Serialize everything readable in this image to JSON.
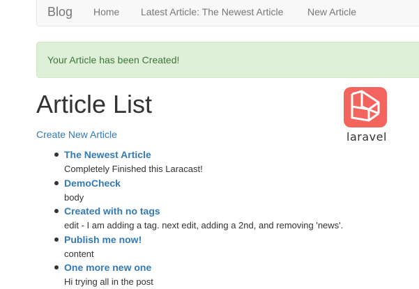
{
  "navbar": {
    "brand": "Blog",
    "links": [
      "Home",
      "Latest Article: The Newest Article",
      "New Article"
    ]
  },
  "alert": {
    "message": "Your Article has been Created!"
  },
  "main": {
    "title": "Article List",
    "create_link": "Create New Article"
  },
  "logo": {
    "text": "laravel",
    "color": "#f4645f"
  },
  "articles": [
    {
      "title": "The Newest Article",
      "body": "Completely Finished this Laracast!"
    },
    {
      "title": "DemoCheck",
      "body": "body"
    },
    {
      "title": "Created with no tags",
      "body": "edit - I am adding a tag. next edit, adding a 2nd, and removing 'news'."
    },
    {
      "title": "Publish me now!",
      "body": "content"
    },
    {
      "title": "One more new one",
      "body": "Hi trying all in the post"
    }
  ]
}
